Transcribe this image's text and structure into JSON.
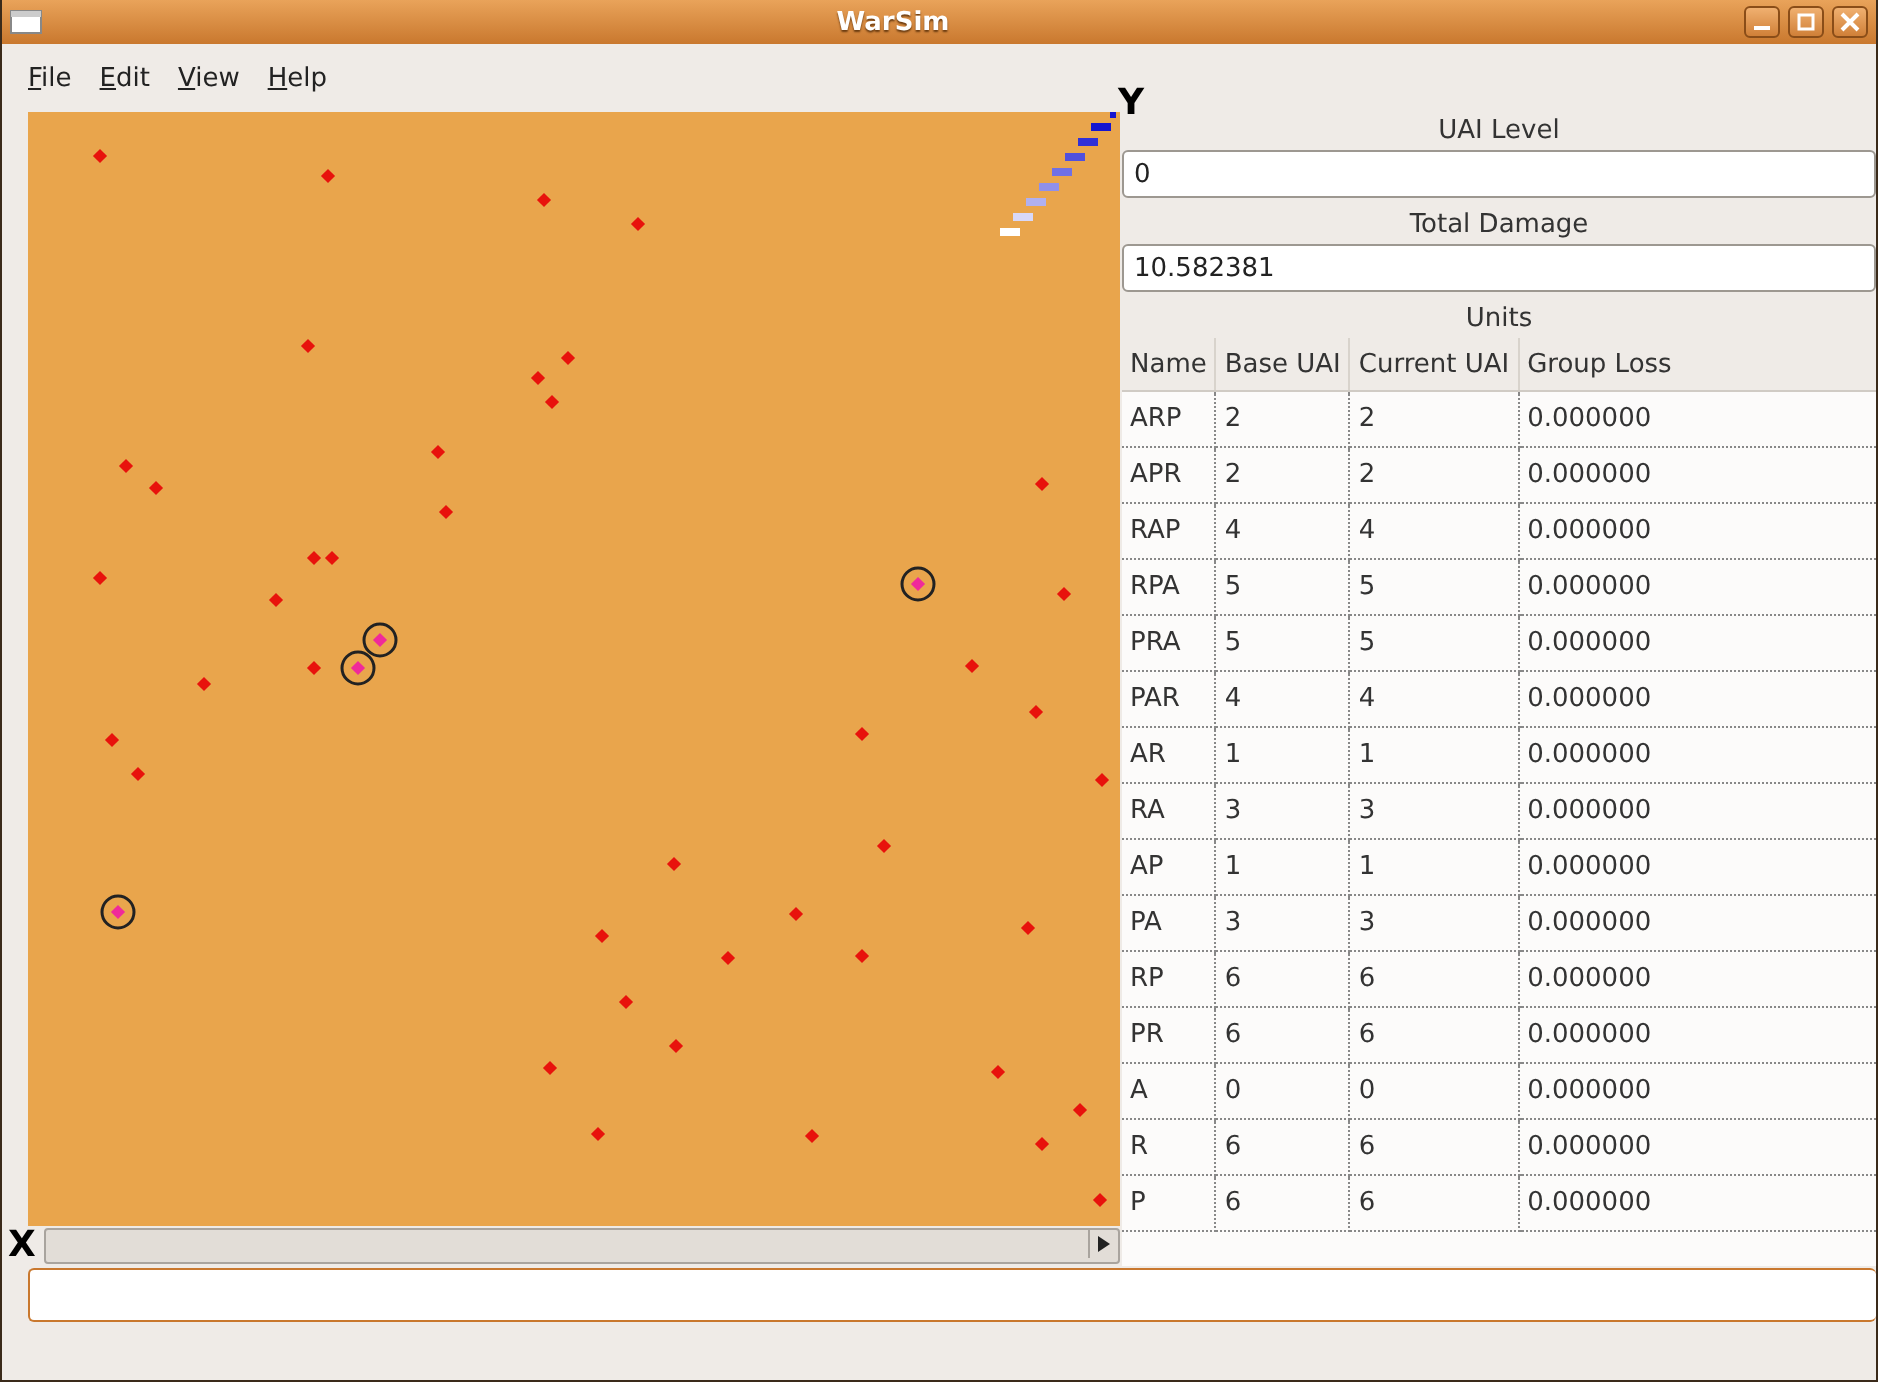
{
  "window": {
    "title": "WarSim"
  },
  "menu": [
    "File",
    "Edit",
    "View",
    "Help"
  ],
  "map": {
    "x_axis_label": "X",
    "y_axis_label": "Y"
  },
  "panel": {
    "uai_level_label": "UAI Level",
    "uai_level_value": "0",
    "total_damage_label": "Total Damage",
    "total_damage_value": "10.582381",
    "units_label": "Units"
  },
  "table": {
    "columns": [
      "Name",
      "Base UAI",
      "Current UAI",
      "Group Loss"
    ],
    "rows": [
      [
        "ARP",
        "2",
        "2",
        "0.000000"
      ],
      [
        "APR",
        "2",
        "2",
        "0.000000"
      ],
      [
        "RAP",
        "4",
        "4",
        "0.000000"
      ],
      [
        "RPA",
        "5",
        "5",
        "0.000000"
      ],
      [
        "PRA",
        "5",
        "5",
        "0.000000"
      ],
      [
        "PAR",
        "4",
        "4",
        "0.000000"
      ],
      [
        "AR",
        "1",
        "1",
        "0.000000"
      ],
      [
        "RA",
        "3",
        "3",
        "0.000000"
      ],
      [
        "AP",
        "1",
        "1",
        "0.000000"
      ],
      [
        "PA",
        "3",
        "3",
        "0.000000"
      ],
      [
        "RP",
        "6",
        "6",
        "0.000000"
      ],
      [
        "PR",
        "6",
        "6",
        "0.000000"
      ],
      [
        "A",
        "0",
        "0",
        "0.000000"
      ],
      [
        "R",
        "6",
        "6",
        "0.000000"
      ],
      [
        "P",
        "6",
        "6",
        "0.000000"
      ]
    ]
  }
}
